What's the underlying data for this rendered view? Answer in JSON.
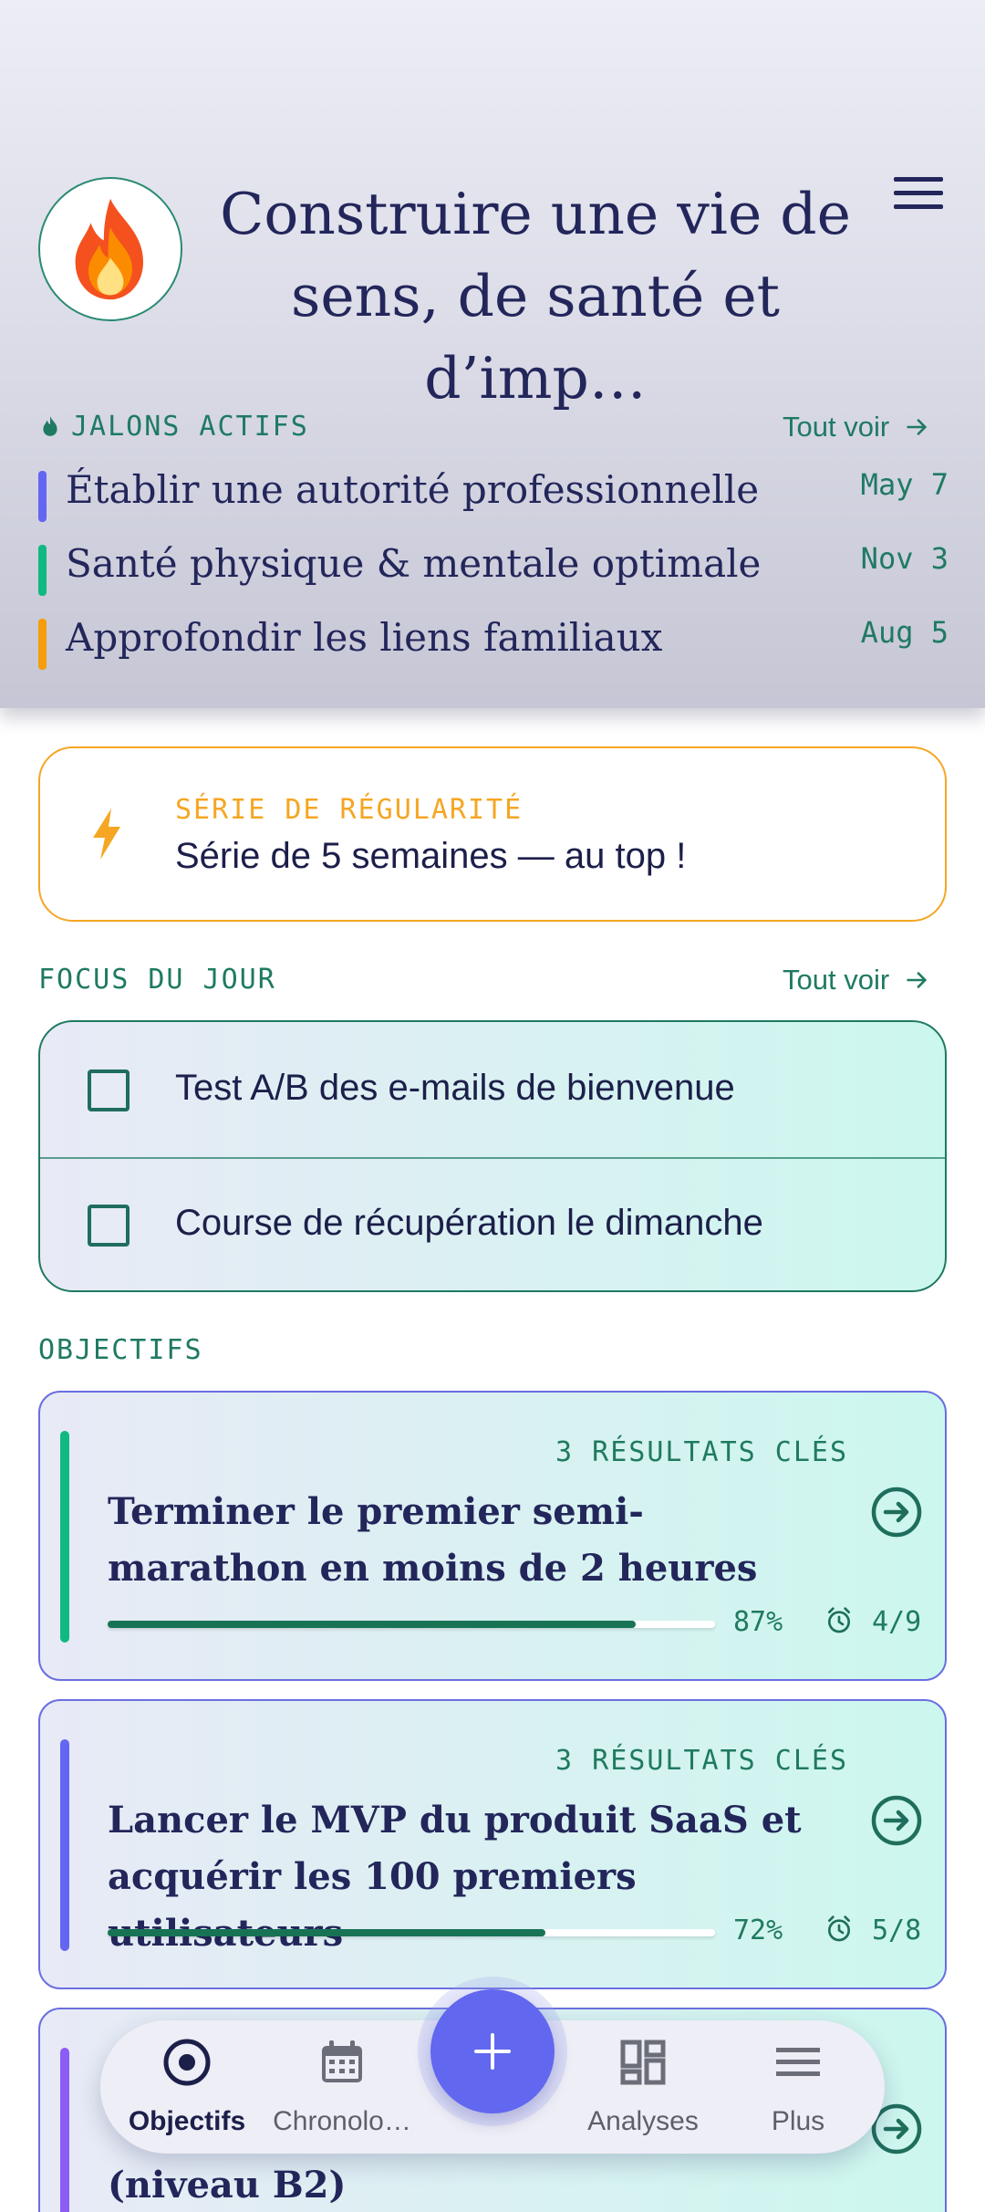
{
  "header": {
    "title": "Construire une vie de sens, de santé et d’imp…",
    "avatar_icon": "fire-icon",
    "menu_icon": "menu-icon"
  },
  "milestones": {
    "label": "JALONS ACTIFS",
    "see_all": "Tout voir",
    "items": [
      {
        "name": "Établir une autorité professionnelle",
        "date": "May 7",
        "color": "#6366f1"
      },
      {
        "name": "Santé physique & mentale optimale",
        "date": "Nov 3",
        "color": "#10b981"
      },
      {
        "name": "Approfondir les liens familiaux",
        "date": "Aug 5",
        "color": "#f59e0b"
      }
    ]
  },
  "streak": {
    "label": "SÉRIE DE RÉGULARITÉ",
    "text": "Série de 5 semaines — au top !",
    "icon": "lightning-icon"
  },
  "focus": {
    "label": "FOCUS DU JOUR",
    "see_all": "Tout voir",
    "tasks": [
      {
        "text": "Test A/B des e-mails de bienvenue",
        "checked": false
      },
      {
        "text": "Course de récupération le dimanche",
        "checked": false
      }
    ]
  },
  "objectives": {
    "label": "OBJECTIFS",
    "items": [
      {
        "key_results": "3 RÉSULTATS CLÉS",
        "title": "Terminer le premier semi-marathon en moins de 2 heures",
        "progress": 0.87,
        "percent": "87%",
        "count": "4/9",
        "accent": "#10b981"
      },
      {
        "key_results": "3 RÉSULTATS CLÉS",
        "title": "Lancer le MVP du produit SaaS et acquérir les 100 premiers utilisateurs",
        "progress": 0.72,
        "percent": "72%",
        "count": "5/8",
        "accent": "#6366f1"
      },
      {
        "key_results": "",
        "title": "(niveau B2)",
        "accent": "#8b5cf6"
      }
    ]
  },
  "nav": {
    "items": [
      {
        "label": "Objectifs",
        "icon": "target-icon",
        "active": true
      },
      {
        "label": "Chronolo…",
        "icon": "calendar-icon",
        "active": false
      },
      {
        "label": "Analyses",
        "icon": "dashboard-icon",
        "active": false
      },
      {
        "label": "Plus",
        "icon": "menu-icon",
        "active": false
      }
    ],
    "fab_icon": "plus-icon"
  }
}
